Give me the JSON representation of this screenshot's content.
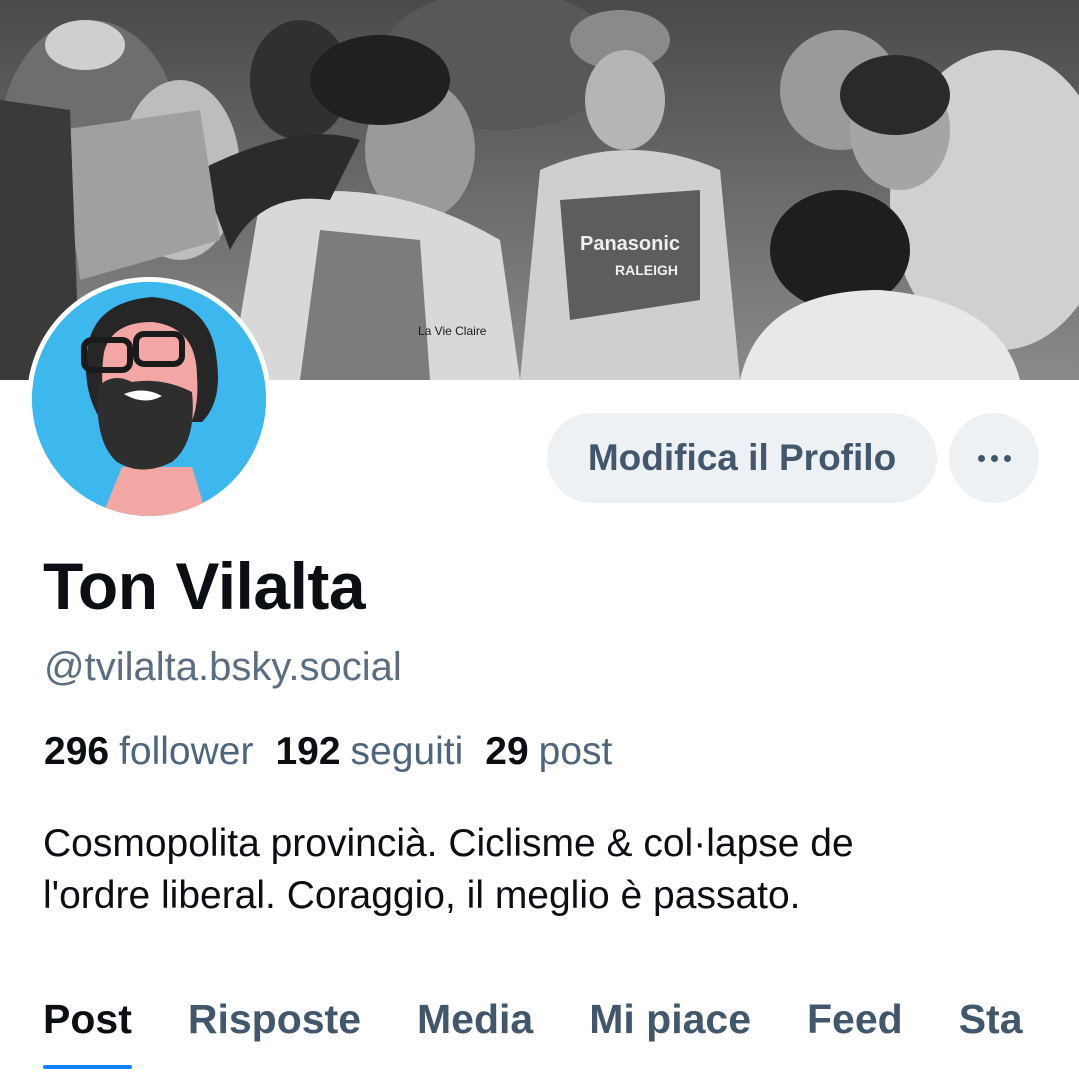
{
  "profile": {
    "display_name": "Ton Vilalta",
    "handle": "@tvilalta.bsky.social",
    "bio_line1": "Cosmopolita provincià. Ciclisme & col·lapse de",
    "bio_line2": "l'ordre liberal. Coraggio, il meglio è passato."
  },
  "stats": {
    "followers_count": "296",
    "followers_label": "follower",
    "following_count": "192",
    "following_label": "seguiti",
    "posts_count": "29",
    "posts_label": "post"
  },
  "actions": {
    "edit_label": "Modifica il Profilo",
    "more_icon": "more-horizontal-icon"
  },
  "banner": {
    "jersey_text_1": "Panasonic",
    "jersey_text_2": "RALEIGH",
    "jersey_text_3": "La Vie Claire"
  },
  "tabs": [
    {
      "label": "Post",
      "active": true
    },
    {
      "label": "Risposte"
    },
    {
      "label": "Media"
    },
    {
      "label": "Mi piace"
    },
    {
      "label": "Feed"
    },
    {
      "label": "Sta"
    }
  ],
  "colors": {
    "accent": "#1083fe",
    "avatar_bg": "#3db8ee",
    "button_bg": "#eef1f4",
    "muted_text": "#5b6d80"
  }
}
